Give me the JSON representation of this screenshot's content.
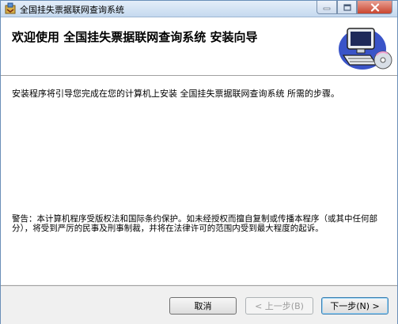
{
  "window": {
    "title": "全国挂失票据联网查询系统"
  },
  "header": {
    "title": "欢迎使用  全国挂失票据联网查询系统  安装向导"
  },
  "content": {
    "intro": "安装程序将引导您完成在您的计算机上安装 全国挂失票据联网查询系统 所需的步骤。",
    "warning": "警告：本计算机程序受版权法和国际条约保护。如未经授权而擅自复制或传播本程序（或其中任何部分），将受到严厉的民事及刑事制裁，并将在法律许可的范围内受到最大程度的起诉。"
  },
  "buttons": {
    "cancel": "取消",
    "back": "< 上一步(B)",
    "next": "下一步(N) >"
  },
  "icons": {
    "app": "installer-icon",
    "header_art": "computer-disc-icon",
    "minimize": "minimize-icon",
    "maximize": "maximize-icon",
    "close": "close-icon"
  },
  "colors": {
    "titlebar": "#c5d9ef",
    "close_button": "#c9452f",
    "default_button_border": "#3c7fb1"
  }
}
